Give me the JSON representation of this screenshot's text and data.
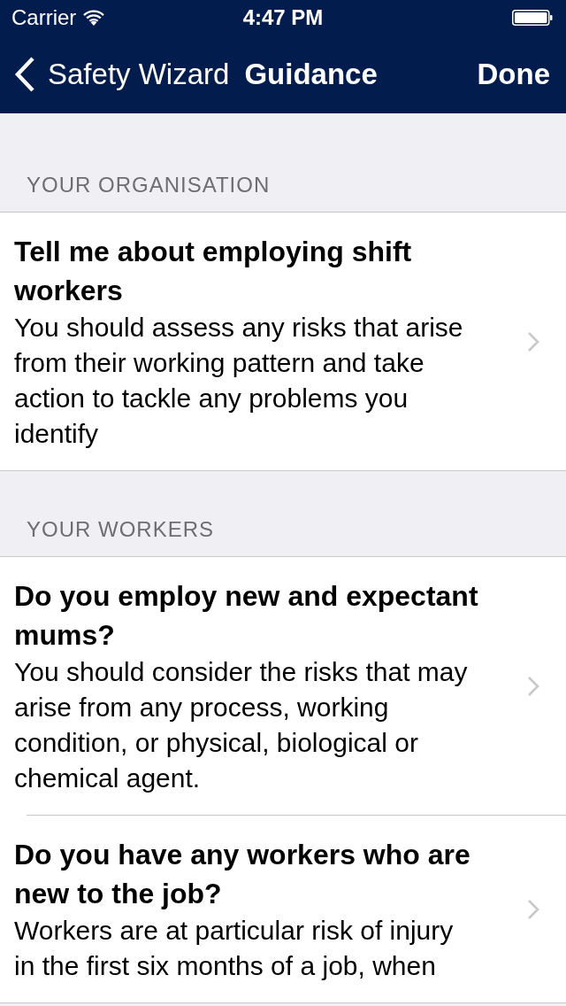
{
  "status_bar": {
    "carrier": "Carrier",
    "time": "4:47 PM"
  },
  "nav_bar": {
    "back_label": "Safety Wizard",
    "title": "Guidance",
    "done_label": "Done"
  },
  "sections": [
    {
      "header": "YOUR ORGANISATION",
      "rows": [
        {
          "title": "Tell me about employing shift workers",
          "description": "You should assess any risks that arise from their working pattern and take action to tackle any problems you identify"
        }
      ]
    },
    {
      "header": "YOUR WORKERS",
      "rows": [
        {
          "title": "Do you employ new and expectant mums?",
          "description": "You should consider the risks that may arise from any process, working condition, or physical, biological or chemical agent."
        },
        {
          "title": "Do you have any workers who are new to the job?",
          "description": "Workers are at particular risk of injury in the first six months of a job, when"
        }
      ]
    }
  ]
}
